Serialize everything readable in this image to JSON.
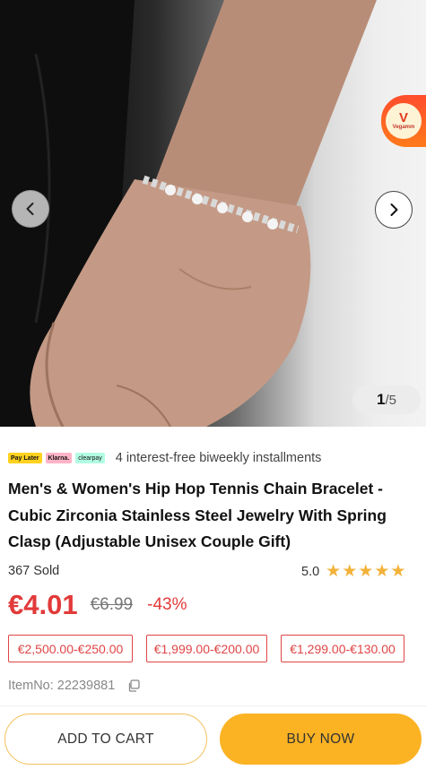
{
  "gallery": {
    "current_index": "1",
    "total": "/5",
    "badge_text": "Vegamm",
    "badge_mark": "V"
  },
  "payment": {
    "logos": [
      "Pay Later",
      "Klarna.",
      "clearpay"
    ],
    "installments_text": "4 interest-free biweekly installments"
  },
  "product": {
    "title": "Men's & Women's Hip Hop Tennis Chain Bracelet - Cubic Zirconia Stainless Steel Jewelry With Spring Clasp (Adjustable Unisex Couple Gift)",
    "sold": "367 Sold",
    "rating": "5.0",
    "stars": 5,
    "price": "€4.01",
    "old_price": "€6.99",
    "discount": "-43%",
    "item_no": "ItemNo: 22239881"
  },
  "coupons": [
    "€2,500.00-€250.00",
    "€1,999.00-€200.00",
    "€1,299.00-€130.00"
  ],
  "actions": {
    "add_to_cart": "ADD TO CART",
    "buy_now": "BUY NOW"
  },
  "colors": {
    "price_red": "#e23a3a",
    "star": "#f2b23a",
    "buy_button": "#fbb324",
    "cart_border": "#f2c05a"
  }
}
